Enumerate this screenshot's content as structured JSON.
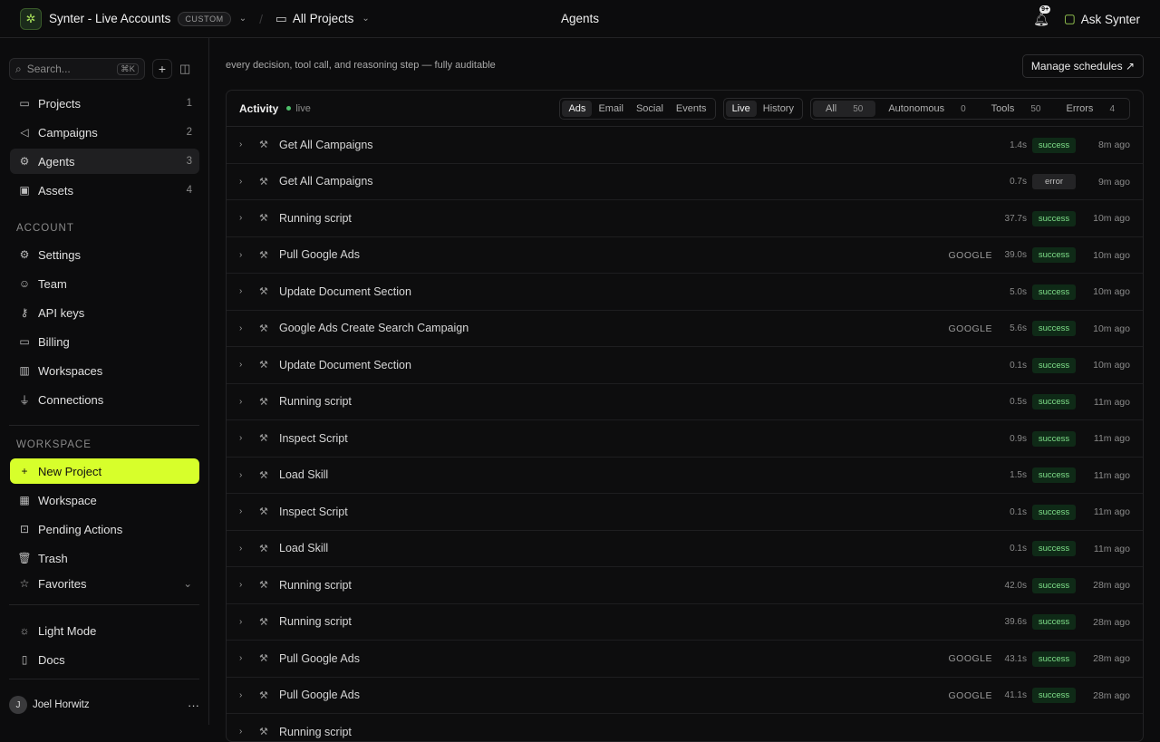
{
  "topbar": {
    "brand_name": "Synter - Live Accounts",
    "brand_badge": "CUSTOM",
    "project_selector": "All Projects",
    "page_title": "Agents",
    "notification_count": "9+",
    "ask_label": "Ask Synter"
  },
  "sidebar": {
    "search_placeholder": "Search...",
    "search_shortcut": "⌘K",
    "main_items": [
      {
        "label": "Projects",
        "count": "1",
        "icon": "folder-icon"
      },
      {
        "label": "Campaigns",
        "count": "2",
        "icon": "megaphone-icon"
      },
      {
        "label": "Agents",
        "count": "3",
        "icon": "agent-icon"
      },
      {
        "label": "Assets",
        "count": "4",
        "icon": "image-icon"
      }
    ],
    "account_label": "ACCOUNT",
    "account_items": [
      {
        "label": "Settings",
        "icon": "gear-icon"
      },
      {
        "label": "Team",
        "icon": "users-icon"
      },
      {
        "label": "API keys",
        "icon": "key-icon"
      },
      {
        "label": "Billing",
        "icon": "card-icon"
      },
      {
        "label": "Workspaces",
        "icon": "building-icon"
      },
      {
        "label": "Connections",
        "icon": "plug-icon"
      }
    ],
    "workspace_label": "WORKSPACE",
    "workspace_items": [
      {
        "label": "New Project",
        "icon": "plus-icon"
      },
      {
        "label": "Workspace",
        "icon": "grid-icon"
      },
      {
        "label": "Pending Actions",
        "icon": "inbox-icon"
      },
      {
        "label": "Trash",
        "icon": "trash-icon"
      }
    ],
    "favorites_label": "Favorites",
    "footer_items": [
      {
        "label": "Light Mode",
        "icon": "sun-icon"
      },
      {
        "label": "Docs",
        "icon": "book-icon"
      }
    ],
    "user": {
      "initial": "J",
      "name": "Joel Horwitz"
    }
  },
  "main": {
    "subtitle": "every decision, tool call, and reasoning step — fully auditable",
    "manage_button": "Manage schedules ↗",
    "activity_title": "Activity",
    "live_label": "live",
    "channel_tabs": [
      "Ads",
      "Email",
      "Social",
      "Events"
    ],
    "mode_tabs": [
      "Live",
      "History"
    ],
    "type_filters": [
      {
        "label": "All",
        "count": "50"
      },
      {
        "label": "Autonomous",
        "count": "0"
      },
      {
        "label": "Tools",
        "count": "50"
      },
      {
        "label": "Errors",
        "count": "4"
      }
    ],
    "rows": [
      {
        "name": "Get All Campaigns",
        "provider": "",
        "duration": "1.4s",
        "status": "success",
        "ago": "8m ago"
      },
      {
        "name": "Get All Campaigns",
        "provider": "",
        "duration": "0.7s",
        "status": "error",
        "ago": "9m ago"
      },
      {
        "name": "Running script",
        "provider": "",
        "duration": "37.7s",
        "status": "success",
        "ago": "10m ago"
      },
      {
        "name": "Pull Google Ads",
        "provider": "GOOGLE",
        "duration": "39.0s",
        "status": "success",
        "ago": "10m ago"
      },
      {
        "name": "Update Document Section",
        "provider": "",
        "duration": "5.0s",
        "status": "success",
        "ago": "10m ago"
      },
      {
        "name": "Google Ads Create Search Campaign",
        "provider": "GOOGLE",
        "duration": "5.6s",
        "status": "success",
        "ago": "10m ago"
      },
      {
        "name": "Update Document Section",
        "provider": "",
        "duration": "0.1s",
        "status": "success",
        "ago": "10m ago"
      },
      {
        "name": "Running script",
        "provider": "",
        "duration": "0.5s",
        "status": "success",
        "ago": "11m ago"
      },
      {
        "name": "Inspect Script",
        "provider": "",
        "duration": "0.9s",
        "status": "success",
        "ago": "11m ago"
      },
      {
        "name": "Load Skill",
        "provider": "",
        "duration": "1.5s",
        "status": "success",
        "ago": "11m ago"
      },
      {
        "name": "Inspect Script",
        "provider": "",
        "duration": "0.1s",
        "status": "success",
        "ago": "11m ago"
      },
      {
        "name": "Load Skill",
        "provider": "",
        "duration": "0.1s",
        "status": "success",
        "ago": "11m ago"
      },
      {
        "name": "Running script",
        "provider": "",
        "duration": "42.0s",
        "status": "success",
        "ago": "28m ago"
      },
      {
        "name": "Running script",
        "provider": "",
        "duration": "39.6s",
        "status": "success",
        "ago": "28m ago"
      },
      {
        "name": "Pull Google Ads",
        "provider": "GOOGLE",
        "duration": "43.1s",
        "status": "success",
        "ago": "28m ago"
      },
      {
        "name": "Pull Google Ads",
        "provider": "GOOGLE",
        "duration": "41.1s",
        "status": "success",
        "ago": "28m ago"
      },
      {
        "name": "Running script",
        "provider": "",
        "duration": "",
        "status": "",
        "ago": ""
      }
    ]
  }
}
